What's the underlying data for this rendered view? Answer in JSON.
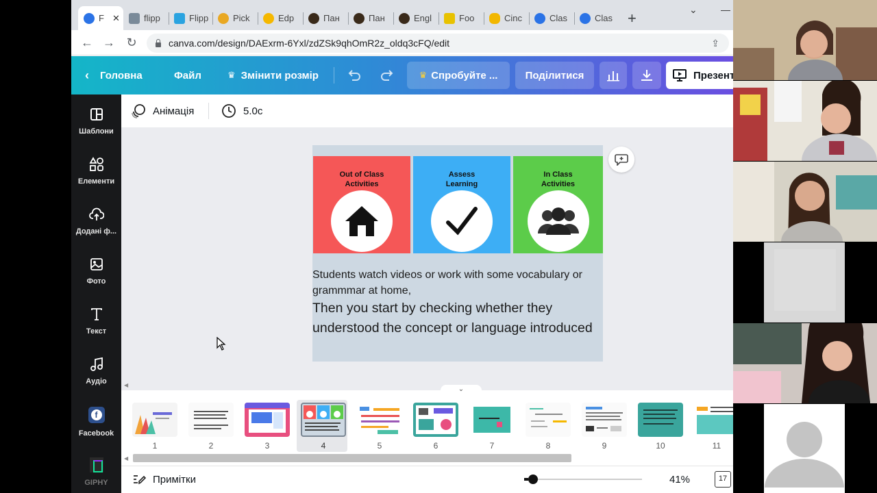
{
  "browser": {
    "tabs": [
      {
        "label": "F",
        "fav_color": "#2b73e6"
      },
      {
        "label": "flipp",
        "fav_color": "#7a8a99"
      },
      {
        "label": "Flipp",
        "fav_color": "#2aa3e0"
      },
      {
        "label": "Pick",
        "fav_color": "#e9a823"
      },
      {
        "label": "Edp",
        "fav_color": "#f5b800"
      },
      {
        "label": "Пан",
        "fav_color": "#3a2a1a"
      },
      {
        "label": "Пан",
        "fav_color": "#3a2a1a"
      },
      {
        "label": "Engl",
        "fav_color": "#3a2a1a"
      },
      {
        "label": "Foo",
        "fav_color": "#e8c200"
      },
      {
        "label": "Cinc",
        "fav_color": "#f2b700"
      },
      {
        "label": "Clas",
        "fav_color": "#2b73e6"
      },
      {
        "label": "Clas",
        "fav_color": "#2b73e6"
      }
    ],
    "url": "canva.com/design/DAExrm-6Yxl/zdZSk9qhOmR2z_oldq3cFQ/edit"
  },
  "canva_header": {
    "back_label": "Головна",
    "file_label": "Файл",
    "resize_label": "Змінити розмір",
    "try_label": "Спробуйте ...",
    "share_label": "Поділитися",
    "present_label": "Презент"
  },
  "sidebar": {
    "items": [
      {
        "label": "Шаблони"
      },
      {
        "label": "Елементи"
      },
      {
        "label": "Додані ф..."
      },
      {
        "label": "Фото"
      },
      {
        "label": "Текст"
      },
      {
        "label": "Аудіо"
      },
      {
        "label": "Facebook"
      },
      {
        "label": "GIPHY"
      }
    ]
  },
  "editor_toolbar": {
    "animation_label": "Анімація",
    "duration_label": "5.0с"
  },
  "slide": {
    "tiles": [
      {
        "title": "Out of Class Activities",
        "color": "#f55757"
      },
      {
        "title": "Assess Learning",
        "color": "#3daef5"
      },
      {
        "title": "In Class Activities",
        "color": "#5ccc4a"
      }
    ],
    "text_line1": " Students watch videos or work with some vocabulary or grammmar at home,",
    "text_line2": "  Then you start by checking whether they understood the concept or language introduced"
  },
  "thumbnails": {
    "pages": [
      "1",
      "2",
      "3",
      "4",
      "5",
      "6",
      "7",
      "8",
      "9",
      "10",
      "11"
    ],
    "selected": "4"
  },
  "bottom": {
    "notes_label": "Примітки",
    "zoom_label": "41%",
    "page_count": "17"
  }
}
